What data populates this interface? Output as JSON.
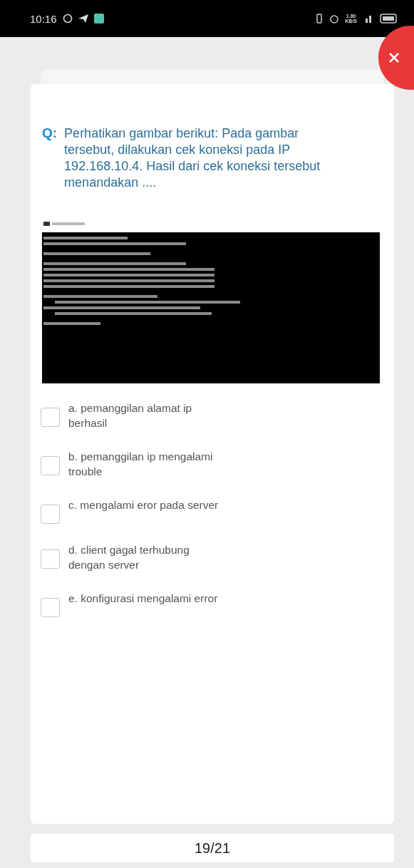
{
  "status_bar": {
    "time": "10:16",
    "speed_value": "1.80",
    "speed_unit": "KB/S"
  },
  "question": {
    "prefix": "Q:",
    "text": "Perhatikan gambar berikut: Pada gambar tersebut, dilakukan cek koneksi pada IP 192.168.10.4. Hasil dari cek koneksi tersebut menandakan ...."
  },
  "options": [
    {
      "label": "a. pemanggilan alamat ip berhasil",
      "checked": false
    },
    {
      "label": "b. pemanggilan ip mengalami trouble",
      "checked": false
    },
    {
      "label": "c. mengalami eror pada server",
      "checked": false
    },
    {
      "label": "d. client gagal terhubung dengan server",
      "checked": false
    },
    {
      "label": "e. konfigurasi mengalami error",
      "checked": false
    }
  ],
  "pager": {
    "text": "19/21"
  }
}
